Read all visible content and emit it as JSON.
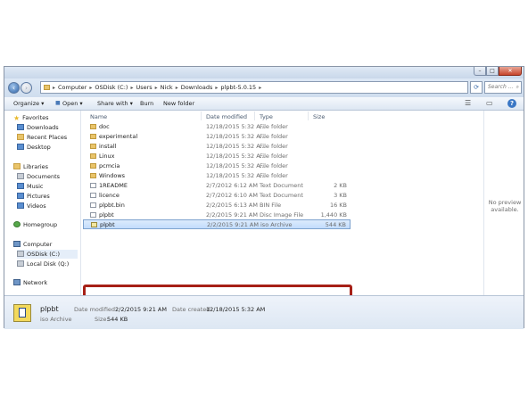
{
  "window": {
    "controls": {
      "minimize": "–",
      "maximize": "□",
      "close": "✕"
    }
  },
  "address": {
    "segments": [
      "Computer",
      "OSDisk (C:)",
      "Users",
      "Nick",
      "Downloads",
      "plpbt-5.0.15"
    ],
    "search_placeholder": "Search ..."
  },
  "toolbar": {
    "organize": "Organize ▾",
    "open": "Open ▾",
    "share": "Share with ▾",
    "burn": "Burn",
    "new_folder": "New folder"
  },
  "sidebar": {
    "favorites": "Favorites",
    "downloads": "Downloads",
    "recent": "Recent Places",
    "desktop": "Desktop",
    "libraries": "Libraries",
    "documents": "Documents",
    "music": "Music",
    "pictures": "Pictures",
    "videos": "Videos",
    "homegroup": "Homegroup",
    "computer": "Computer",
    "osdisk": "OSDisk (C:)",
    "localdisk": "Local Disk (Q:)",
    "network": "Network"
  },
  "columns": {
    "name": "Name",
    "date": "Date modified",
    "type": "Type",
    "size": "Size"
  },
  "files": [
    {
      "name": "doc",
      "date": "12/18/2015 5:32 A...",
      "type": "File folder",
      "size": ""
    },
    {
      "name": "experimental",
      "date": "12/18/2015 5:32 A...",
      "type": "File folder",
      "size": ""
    },
    {
      "name": "install",
      "date": "12/18/2015 5:32 A...",
      "type": "File folder",
      "size": ""
    },
    {
      "name": "Linux",
      "date": "12/18/2015 5:32 A...",
      "type": "File folder",
      "size": ""
    },
    {
      "name": "pcmcia",
      "date": "12/18/2015 5:32 A...",
      "type": "File folder",
      "size": ""
    },
    {
      "name": "Windows",
      "date": "12/18/2015 5:32 A...",
      "type": "File folder",
      "size": ""
    },
    {
      "name": "1README",
      "date": "2/7/2012 6:12 AM",
      "type": "Text Document",
      "size": "2 KB"
    },
    {
      "name": "licence",
      "date": "2/7/2012 6:10 AM",
      "type": "Text Document",
      "size": "3 KB"
    },
    {
      "name": "plpbt.bin",
      "date": "2/2/2015 6:13 AM",
      "type": "BIN File",
      "size": "16 KB"
    },
    {
      "name": "plpbt",
      "date": "2/2/2015 9:21 AM",
      "type": "Disc Image File",
      "size": "1,440 KB"
    },
    {
      "name": "plpbt",
      "date": "2/2/2015 9:21 AM",
      "type": "iso Archive",
      "size": "544 KB"
    }
  ],
  "preview_text": "No preview available.",
  "details": {
    "name": "plpbt",
    "type": "iso Archive",
    "date_modified_label": "Date modified:",
    "date_modified": "2/2/2015 9:21 AM",
    "date_created_label": "Date created:",
    "date_created": "12/18/2015 5:32 AM",
    "size_label": "Size:",
    "size": "544 KB"
  },
  "colors": {
    "highlight_box": "#a62017",
    "selection": "#c1dcfc",
    "folder": "#e9c46a"
  }
}
